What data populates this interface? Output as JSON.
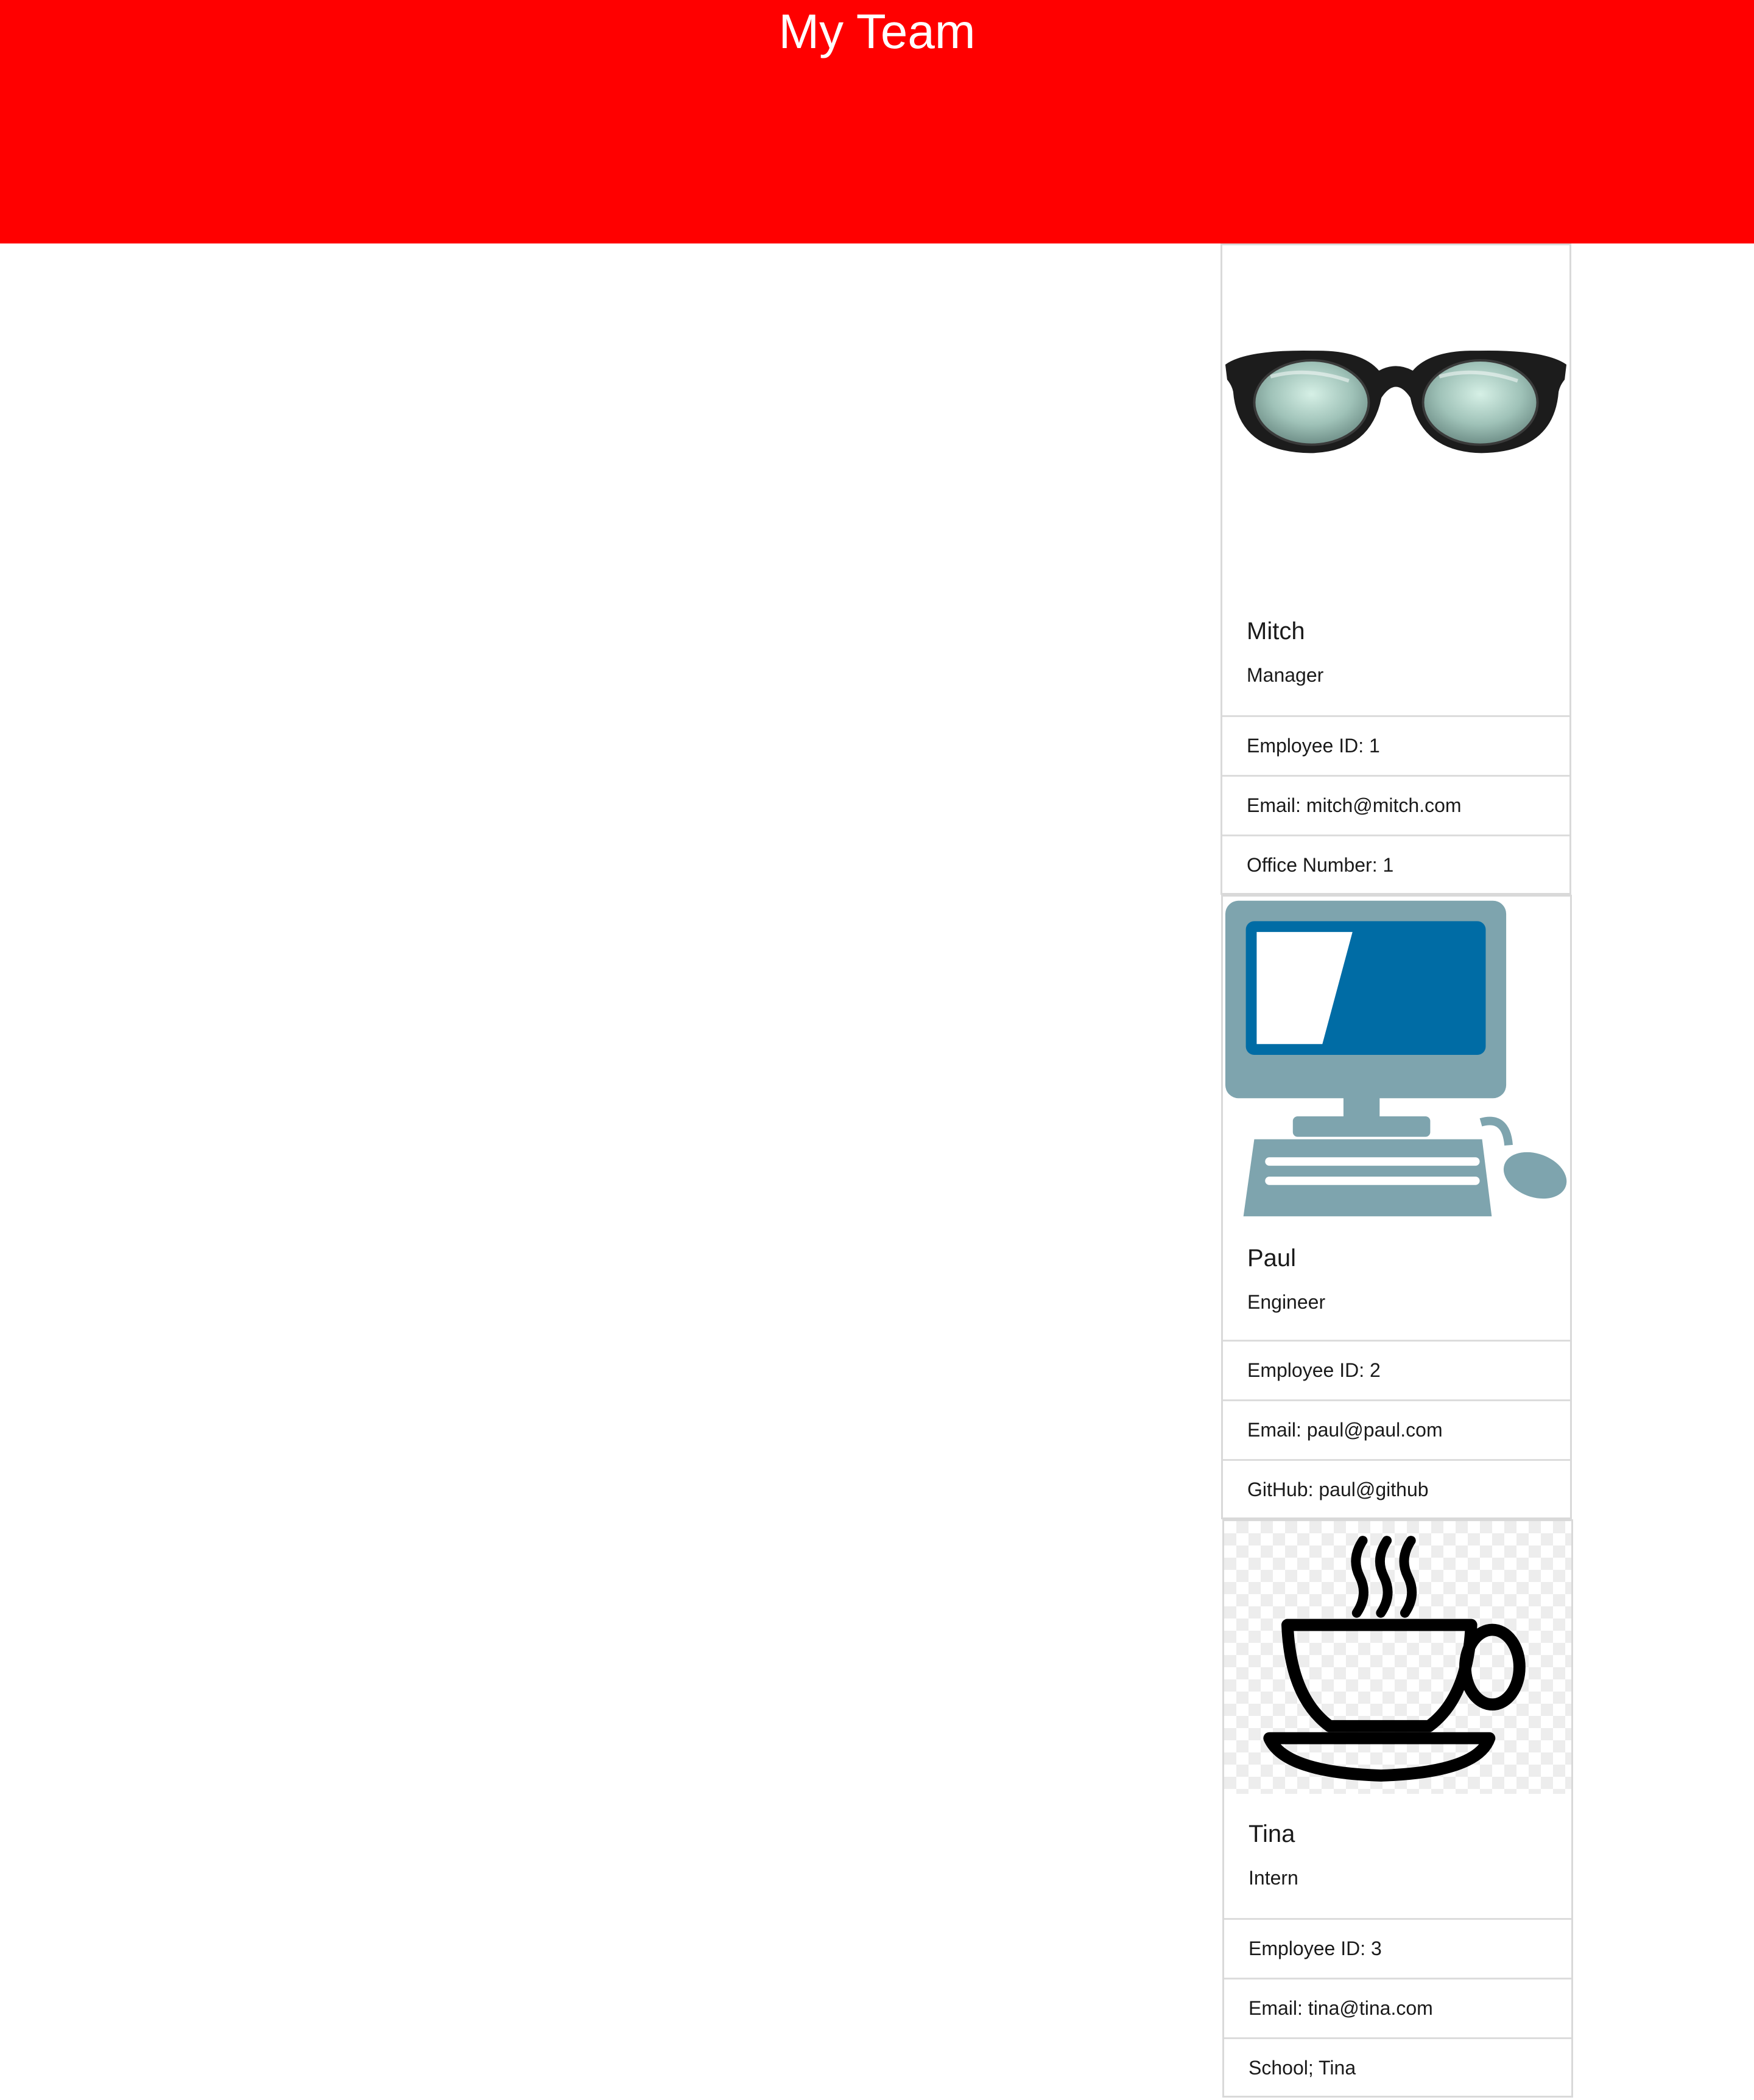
{
  "header": {
    "title": "My Team"
  },
  "colors": {
    "header_bg": "#ff0000",
    "header_text": "#ffffff"
  },
  "cards": [
    {
      "icon": "glasses-icon",
      "name": "Mitch",
      "role": "Manager",
      "details": [
        "Employee ID: 1",
        "Email: mitch@mitch.com",
        "Office Number: 1"
      ]
    },
    {
      "icon": "computer-icon",
      "name": "Paul",
      "role": "Engineer",
      "details": [
        "Employee ID: 2",
        "Email: paul@paul.com",
        "GitHub: paul@github"
      ]
    },
    {
      "icon": "coffee-cup-icon",
      "name": "Tina",
      "role": "Intern",
      "details": [
        "Employee ID: 3",
        "Email: tina@tina.com",
        "School; Tina"
      ]
    }
  ]
}
